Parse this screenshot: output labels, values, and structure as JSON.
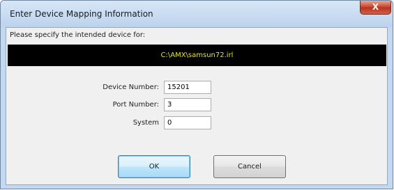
{
  "dialog": {
    "title": "Enter Device Mapping Information",
    "close_label": "X",
    "prompt": "Please specify the intended device for:",
    "file_path": "C:\\AMX\\samsun72.irl",
    "fields": [
      {
        "label": "Device Number:",
        "value": "15201"
      },
      {
        "label": "Port Number:",
        "value": "3"
      },
      {
        "label": "System",
        "value": "0"
      }
    ],
    "ok_label": "OK",
    "cancel_label": "Cancel"
  },
  "colors": {
    "path_bar_background": "#000000",
    "path_text": "#e9e800",
    "close_button": "#c7442e",
    "title_bar": "#c2d9f1"
  }
}
